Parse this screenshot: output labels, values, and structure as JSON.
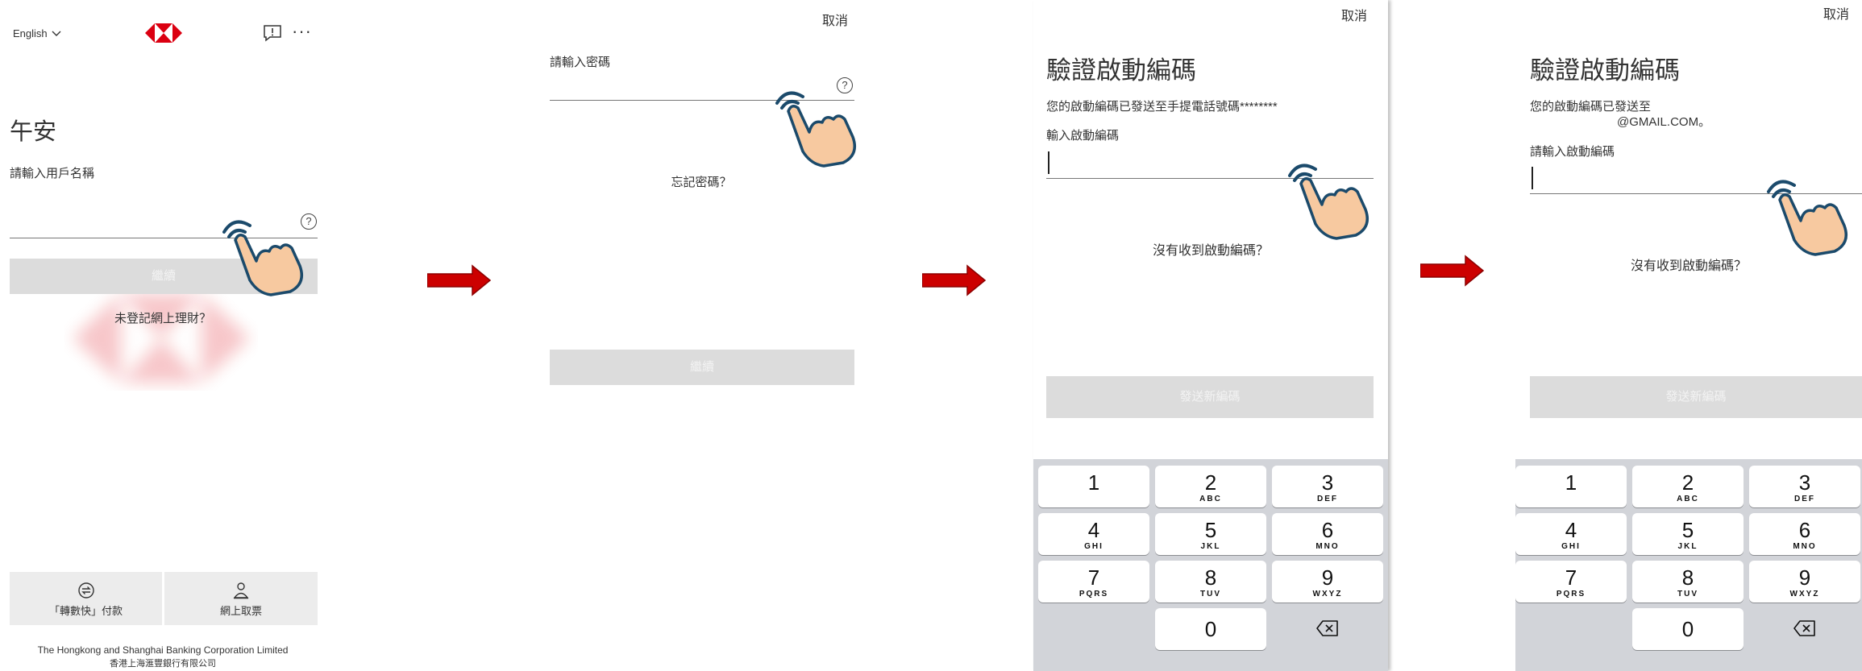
{
  "colors": {
    "brand_red": "#db0011",
    "arrow_red": "#cc0000",
    "button_gray": "#dcdcdc",
    "keypad_bg": "#d2d4d9"
  },
  "screen1": {
    "language": "English",
    "greeting": "午安",
    "username_label": "請輸入用戶名稱",
    "continue_button": "繼續",
    "not_registered": "未登記網上理財？",
    "bottom_left": "「轉數快」付款",
    "bottom_right": "網上取票",
    "footer_en": "The Hongkong and Shanghai Banking Corporation Limited",
    "footer_zh": "香港上海滙豐銀行有限公司"
  },
  "screen2": {
    "cancel": "取消",
    "password_label": "請輸入密碼",
    "forgot_password": "忘記密碼？",
    "continue_button": "繼續"
  },
  "screen3": {
    "cancel": "取消",
    "title": "驗證啟動編碼",
    "sent_message": "您的啟動編碼已發送至手提電話號碼********",
    "input_label": "輸入啟動編碼",
    "not_received": "沒有收到啟動編碼？",
    "send_new_button": "發送新編碼"
  },
  "screen4": {
    "cancel": "取消",
    "title": "驗證啟動編碼",
    "sent_message_line1": "您的啟動編碼已發送至",
    "sent_message_line2": "@GMAIL.COM。",
    "input_label": "請輸入啟動編碼",
    "not_received": "沒有收到啟動編碼？",
    "send_new_button": "發送新編碼"
  },
  "keypad": {
    "keys": [
      {
        "num": "1",
        "letters": ""
      },
      {
        "num": "2",
        "letters": "ABC"
      },
      {
        "num": "3",
        "letters": "DEF"
      },
      {
        "num": "4",
        "letters": "GHI"
      },
      {
        "num": "5",
        "letters": "JKL"
      },
      {
        "num": "6",
        "letters": "MNO"
      },
      {
        "num": "7",
        "letters": "PQRS"
      },
      {
        "num": "8",
        "letters": "TUV"
      },
      {
        "num": "9",
        "letters": "WXYZ"
      },
      {
        "num": "0",
        "letters": ""
      }
    ]
  }
}
